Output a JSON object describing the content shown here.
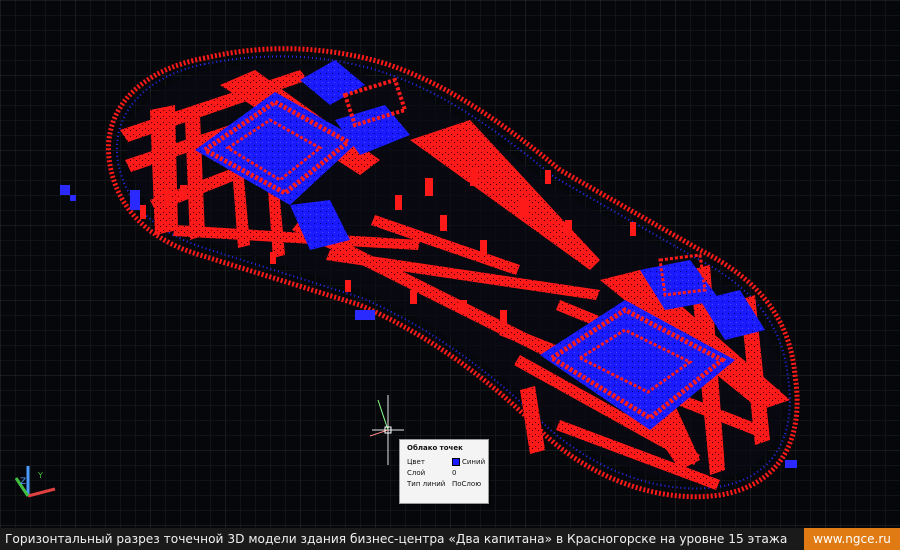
{
  "tooltip": {
    "title": "Облако точек",
    "rows": [
      {
        "label": "Цвет",
        "value": "Синий",
        "color": "#1a1aff"
      },
      {
        "label": "Слой",
        "value": "0"
      },
      {
        "label": "Тип линий",
        "value": "ПоСлою"
      }
    ]
  },
  "caption": "Горизонтальный разрез точечной 3D модели здания бизнес-центра «Два капитана» в Красногорске на уровне 15 этажа",
  "site_label": "www.ngce.ru",
  "colors": {
    "point_cloud_red": "#ff1a1a",
    "point_cloud_blue": "#1a1aff",
    "background": "#05070a",
    "grid": "#2a2f33",
    "site_badge": "#e07b14"
  },
  "icons": [
    "ucs-axes-icon",
    "crosshair-cursor-icon"
  ]
}
